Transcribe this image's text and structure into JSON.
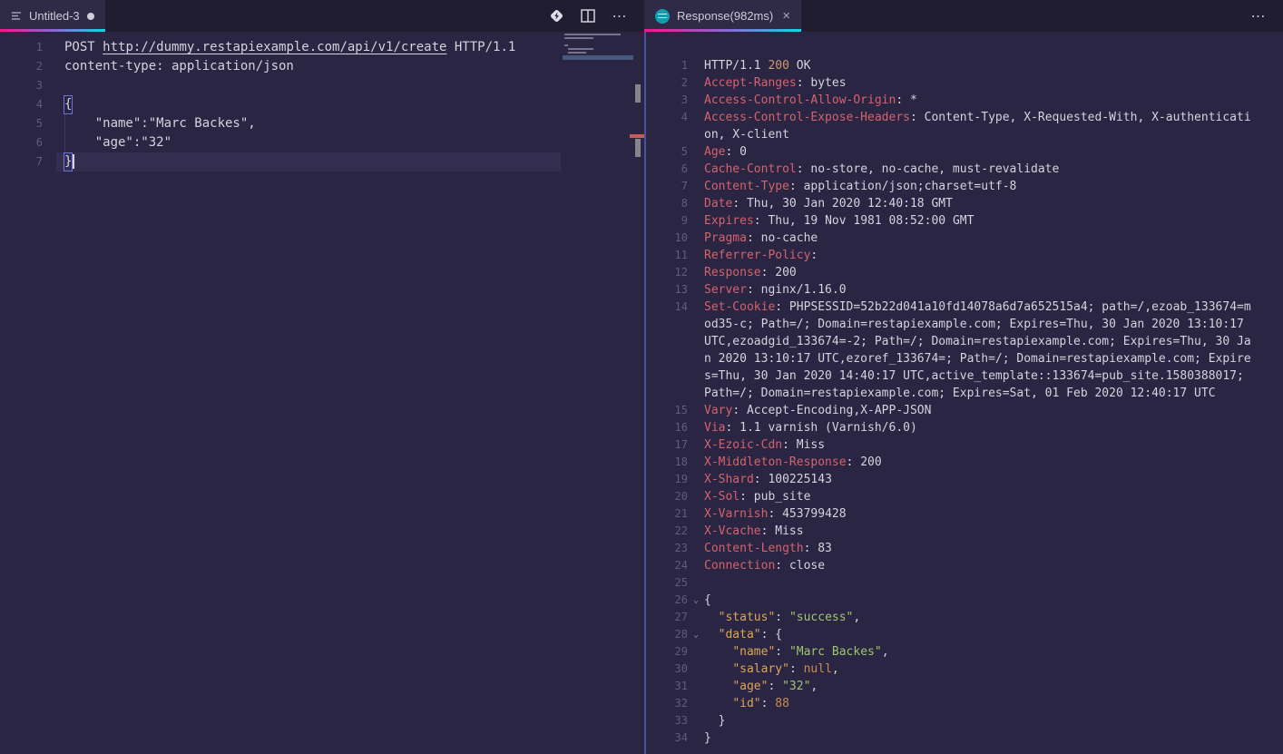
{
  "theme": {
    "editor_bg": "#292542",
    "tabstrip_bg": "#211d31",
    "active_tab_bg": "#2f2a46",
    "tab_underline_gradient": [
      "#f2188c",
      "#8a67d8",
      "#13d4e6"
    ],
    "divider_accent": "#4d519b",
    "text": "#d6d2de",
    "line_number": "#615c7b",
    "header_name": "#d4636d",
    "status_code": "#d19a66",
    "json_key": "#dca558",
    "json_string": "#a2c472",
    "json_literal": "#cd8a50",
    "response_icon_bg": "#1a98ae"
  },
  "icons": {
    "file_icon": "text-file",
    "modified_dot": "●",
    "send_request_icon": "diamond-send",
    "split_editor_icon": "split-square",
    "more_icon": "⋯",
    "close_icon": "×",
    "fold_icon": "⌄",
    "response_tab_icon": "rest-client-circle"
  },
  "left_editor": {
    "tab_label": "Untitled-3",
    "modified": true,
    "lines": [
      {
        "n": 1,
        "s": [
          {
            "t": "POST ",
            "c": "txt"
          },
          {
            "t": "http://dummy.restapiexample.com/api/v1/create",
            "c": "link"
          },
          {
            "t": " HTTP/1.1",
            "c": "txt"
          }
        ]
      },
      {
        "n": 2,
        "s": [
          {
            "t": "content-type: application/json",
            "c": "txt"
          }
        ]
      },
      {
        "n": 3,
        "s": []
      },
      {
        "n": 4,
        "s": [
          {
            "t": "{",
            "c": "bracket"
          }
        ]
      },
      {
        "n": 5,
        "s": [
          {
            "t": "    \"name\":\"Marc Backes\",",
            "c": "txt"
          }
        ]
      },
      {
        "n": 6,
        "s": [
          {
            "t": "    \"age\":\"32\"",
            "c": "txt"
          }
        ]
      },
      {
        "n": 7,
        "current": true,
        "cursor": true,
        "s": [
          {
            "t": "}",
            "c": "bracket"
          }
        ]
      }
    ]
  },
  "right_editor": {
    "tab_label": "Response(982ms)",
    "lines": [
      {
        "n": 1,
        "s": [
          {
            "t": "HTTP/1.1 ",
            "c": "txt"
          },
          {
            "t": "200",
            "c": "orange"
          },
          {
            "t": " OK",
            "c": "txt"
          }
        ]
      },
      {
        "n": 2,
        "s": [
          {
            "t": "Accept-Ranges",
            "c": "hdr"
          },
          {
            "t": ": bytes",
            "c": "txt"
          }
        ]
      },
      {
        "n": 3,
        "s": [
          {
            "t": "Access-Control-Allow-Origin",
            "c": "hdr"
          },
          {
            "t": ": *",
            "c": "txt"
          }
        ]
      },
      {
        "n": 4,
        "s": [
          {
            "t": "Access-Control-Expose-Headers",
            "c": "hdr"
          },
          {
            "t": ": Content-Type, X-Requested-With, X-authentication, X-client",
            "c": "txt"
          }
        ]
      },
      {
        "n": 5,
        "s": [
          {
            "t": "Age",
            "c": "hdr"
          },
          {
            "t": ": 0",
            "c": "txt"
          }
        ]
      },
      {
        "n": 6,
        "s": [
          {
            "t": "Cache-Control",
            "c": "hdr"
          },
          {
            "t": ": no-store, no-cache, must-revalidate",
            "c": "txt"
          }
        ]
      },
      {
        "n": 7,
        "s": [
          {
            "t": "Content-Type",
            "c": "hdr"
          },
          {
            "t": ": application/json;charset=utf-8",
            "c": "txt"
          }
        ]
      },
      {
        "n": 8,
        "s": [
          {
            "t": "Date",
            "c": "hdr"
          },
          {
            "t": ": Thu, 30 Jan 2020 12:40:18 GMT",
            "c": "txt"
          }
        ]
      },
      {
        "n": 9,
        "s": [
          {
            "t": "Expires",
            "c": "hdr"
          },
          {
            "t": ": Thu, 19 Nov 1981 08:52:00 GMT",
            "c": "txt"
          }
        ]
      },
      {
        "n": 10,
        "s": [
          {
            "t": "Pragma",
            "c": "hdr"
          },
          {
            "t": ": no-cache",
            "c": "txt"
          }
        ]
      },
      {
        "n": 11,
        "s": [
          {
            "t": "Referrer-Policy",
            "c": "hdr"
          },
          {
            "t": ":",
            "c": "txt"
          }
        ]
      },
      {
        "n": 12,
        "s": [
          {
            "t": "Response",
            "c": "hdr"
          },
          {
            "t": ": 200",
            "c": "txt"
          }
        ]
      },
      {
        "n": 13,
        "s": [
          {
            "t": "Server",
            "c": "hdr"
          },
          {
            "t": ": nginx/1.16.0",
            "c": "txt"
          }
        ]
      },
      {
        "n": 14,
        "s": [
          {
            "t": "Set-Cookie",
            "c": "hdr"
          },
          {
            "t": ": PHPSESSID=52b22d041a10fd14078a6d7a652515a4; path=/,ezoab_133674=mod35-c; Path=/; Domain=restapiexample.com; Expires=Thu, 30 Jan 2020 13:10:17 UTC,ezoadgid_133674=-2; Path=/; Domain=restapiexample.com; Expires=Thu, 30 Jan 2020 13:10:17 UTC,ezoref_133674=; Path=/; Domain=restapiexample.com; Expires=Thu, 30 Jan 2020 14:40:17 UTC,active_template::133674=pub_site.1580388017; Path=/; Domain=restapiexample.com; Expires=Sat, 01 Feb 2020 12:40:17 UTC",
            "c": "txt"
          }
        ]
      },
      {
        "n": 15,
        "s": [
          {
            "t": "Vary",
            "c": "hdr"
          },
          {
            "t": ": Accept-Encoding,X-APP-JSON",
            "c": "txt"
          }
        ]
      },
      {
        "n": 16,
        "s": [
          {
            "t": "Via",
            "c": "hdr"
          },
          {
            "t": ": 1.1 varnish (Varnish/6.0)",
            "c": "txt"
          }
        ]
      },
      {
        "n": 17,
        "s": [
          {
            "t": "X-Ezoic-Cdn",
            "c": "hdr"
          },
          {
            "t": ": Miss",
            "c": "txt"
          }
        ]
      },
      {
        "n": 18,
        "s": [
          {
            "t": "X-Middleton-Response",
            "c": "hdr"
          },
          {
            "t": ": 200",
            "c": "txt"
          }
        ]
      },
      {
        "n": 19,
        "s": [
          {
            "t": "X-Shard",
            "c": "hdr"
          },
          {
            "t": ": 100225143",
            "c": "txt"
          }
        ]
      },
      {
        "n": 20,
        "s": [
          {
            "t": "X-Sol",
            "c": "hdr"
          },
          {
            "t": ": pub_site",
            "c": "txt"
          }
        ]
      },
      {
        "n": 21,
        "s": [
          {
            "t": "X-Varnish",
            "c": "hdr"
          },
          {
            "t": ": 453799428",
            "c": "txt"
          }
        ]
      },
      {
        "n": 22,
        "s": [
          {
            "t": "X-Vcache",
            "c": "hdr"
          },
          {
            "t": ": Miss",
            "c": "txt"
          }
        ]
      },
      {
        "n": 23,
        "s": [
          {
            "t": "Content-Length",
            "c": "hdr"
          },
          {
            "t": ": 83",
            "c": "txt"
          }
        ]
      },
      {
        "n": 24,
        "s": [
          {
            "t": "Connection",
            "c": "hdr"
          },
          {
            "t": ": close",
            "c": "txt"
          }
        ]
      },
      {
        "n": 25,
        "s": []
      },
      {
        "n": 26,
        "fold": true,
        "s": [
          {
            "t": "{",
            "c": "txt"
          }
        ]
      },
      {
        "n": 27,
        "s": [
          {
            "t": "  ",
            "c": "txt"
          },
          {
            "t": "\"status\"",
            "c": "key"
          },
          {
            "t": ": ",
            "c": "txt"
          },
          {
            "t": "\"success\"",
            "c": "str"
          },
          {
            "t": ",",
            "c": "txt"
          }
        ]
      },
      {
        "n": 28,
        "fold": true,
        "s": [
          {
            "t": "  ",
            "c": "txt"
          },
          {
            "t": "\"data\"",
            "c": "key"
          },
          {
            "t": ": {",
            "c": "txt"
          }
        ]
      },
      {
        "n": 29,
        "s": [
          {
            "t": "    ",
            "c": "txt"
          },
          {
            "t": "\"name\"",
            "c": "key"
          },
          {
            "t": ": ",
            "c": "txt"
          },
          {
            "t": "\"Marc Backes\"",
            "c": "str"
          },
          {
            "t": ",",
            "c": "txt"
          }
        ]
      },
      {
        "n": 30,
        "s": [
          {
            "t": "    ",
            "c": "txt"
          },
          {
            "t": "\"salary\"",
            "c": "key"
          },
          {
            "t": ": ",
            "c": "txt"
          },
          {
            "t": "null",
            "c": "lit"
          },
          {
            "t": ",",
            "c": "txt"
          }
        ]
      },
      {
        "n": 31,
        "s": [
          {
            "t": "    ",
            "c": "txt"
          },
          {
            "t": "\"age\"",
            "c": "key"
          },
          {
            "t": ": ",
            "c": "txt"
          },
          {
            "t": "\"32\"",
            "c": "str"
          },
          {
            "t": ",",
            "c": "txt"
          }
        ]
      },
      {
        "n": 32,
        "s": [
          {
            "t": "    ",
            "c": "txt"
          },
          {
            "t": "\"id\"",
            "c": "key"
          },
          {
            "t": ": ",
            "c": "txt"
          },
          {
            "t": "88",
            "c": "lit"
          }
        ]
      },
      {
        "n": 33,
        "s": [
          {
            "t": "  }",
            "c": "txt"
          }
        ]
      },
      {
        "n": 34,
        "s": [
          {
            "t": "}",
            "c": "txt"
          }
        ]
      }
    ]
  }
}
